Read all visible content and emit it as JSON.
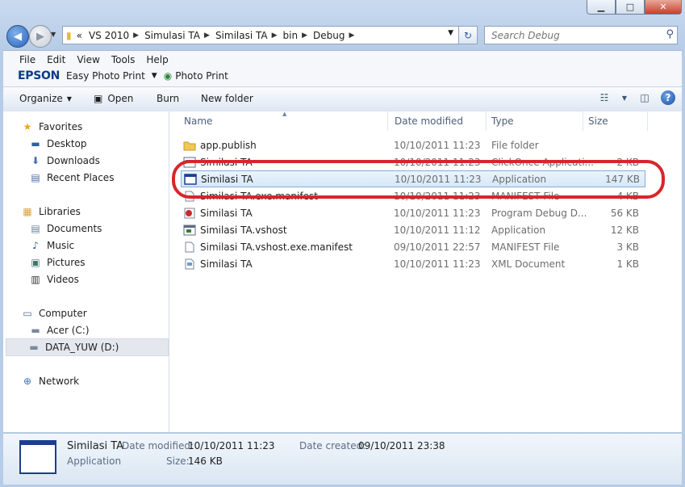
{
  "window": {
    "minimize": "▁",
    "maximize": "□",
    "close": "✕"
  },
  "address": {
    "overflow": "«",
    "crumbs": [
      "VS 2010",
      "Simulasi TA",
      "Similasi TA",
      "bin",
      "Debug"
    ]
  },
  "search": {
    "placeholder": "Search Debug"
  },
  "menu": [
    "File",
    "Edit",
    "View",
    "Tools",
    "Help"
  ],
  "epson": {
    "brand": "EPSON",
    "easy_photo_print": "Easy Photo Print",
    "photo_print": "Photo Print"
  },
  "commands": {
    "organize": "Organize",
    "open": "Open",
    "burn": "Burn",
    "new_folder": "New folder"
  },
  "nav": {
    "favorites": "Favorites",
    "desktop": "Desktop",
    "downloads": "Downloads",
    "recent_places": "Recent Places",
    "libraries": "Libraries",
    "documents": "Documents",
    "music": "Music",
    "pictures": "Pictures",
    "videos": "Videos",
    "computer": "Computer",
    "acer": "Acer (C:)",
    "data_yuw": "DATA_YUW (D:)",
    "network": "Network"
  },
  "columns": {
    "name": "Name",
    "date_modified": "Date modified",
    "type": "Type",
    "size": "Size"
  },
  "files": [
    {
      "name": "app.publish",
      "date": "10/10/2011 11:23",
      "type": "File folder",
      "size": "",
      "icon": "folder-icon"
    },
    {
      "name": "Similasi TA",
      "date": "10/10/2011 11:23",
      "type": "ClickOnce Applicati...",
      "size": "2 KB",
      "icon": "clickonce-icon"
    },
    {
      "name": "Similasi TA",
      "date": "10/10/2011 11:23",
      "type": "Application",
      "size": "147 KB",
      "icon": "application-icon"
    },
    {
      "name": "Similasi TA.exe.manifest",
      "date": "10/10/2011 11:23",
      "type": "MANIFEST File",
      "size": "4 KB",
      "icon": "manifest-file-icon"
    },
    {
      "name": "Similasi TA",
      "date": "10/10/2011 11:23",
      "type": "Program Debug D...",
      "size": "56 KB",
      "icon": "debug-database-icon"
    },
    {
      "name": "Similasi TA.vshost",
      "date": "10/10/2011 11:12",
      "type": "Application",
      "size": "12 KB",
      "icon": "application-icon"
    },
    {
      "name": "Similasi TA.vshost.exe.manifest",
      "date": "09/10/2011 22:57",
      "type": "MANIFEST File",
      "size": "3 KB",
      "icon": "manifest-file-icon"
    },
    {
      "name": "Similasi TA",
      "date": "10/10/2011 11:23",
      "type": "XML Document",
      "size": "1 KB",
      "icon": "xml-document-icon"
    }
  ],
  "details": {
    "name": "Similasi TA",
    "type": "Application",
    "date_modified_label": "Date modified:",
    "date_modified": "10/10/2011 11:23",
    "date_created_label": "Date created:",
    "date_created": "09/10/2011 23:38",
    "size_label": "Size:",
    "size": "146 KB"
  },
  "colors": {
    "highlight_ring": "#d7262b",
    "selection": "#d6e8f9"
  }
}
